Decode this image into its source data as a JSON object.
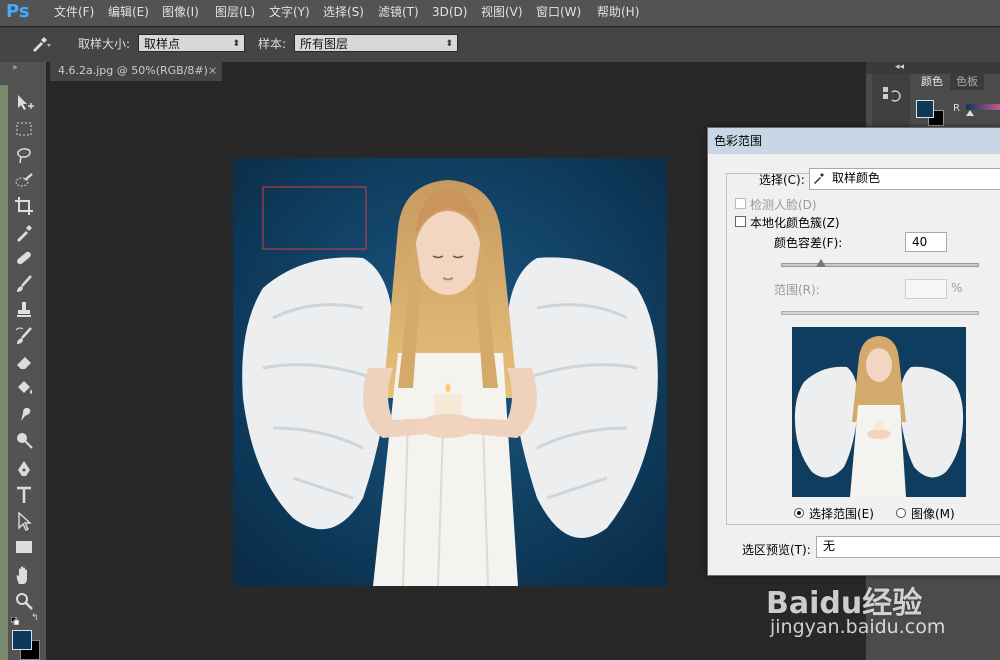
{
  "app": {
    "logo": "Ps"
  },
  "menu": [
    "文件(F)",
    "编辑(E)",
    "图像(I)",
    "图层(L)",
    "文字(Y)",
    "选择(S)",
    "滤镜(T)",
    "3D(D)",
    "视图(V)",
    "窗口(W)",
    "帮助(H)"
  ],
  "options": {
    "sample_size_label": "取样大小:",
    "sample_size_value": "取样点",
    "sample_label": "样本:",
    "sample_value": "所有图层"
  },
  "document": {
    "tab_title": "4.6.2a.jpg @ 50%(RGB/8#)",
    "close": "×"
  },
  "panels": {
    "tab_color": "颜色",
    "tab_swatches": "色板",
    "channel_r": "R"
  },
  "dialog": {
    "title": "色彩范围",
    "select_label": "选择(C):",
    "select_value": "取样颜色",
    "detect_faces": "检测人脸(D)",
    "localized_clusters": "本地化颜色簇(Z)",
    "fuzziness_label": "颜色容差(F):",
    "fuzziness_value": "40",
    "fuzziness_level": 0.2,
    "range_label": "范围(R):",
    "range_unit": "%",
    "radio_selection": "选择范围(E)",
    "radio_image": "图像(M)",
    "preview_label": "选区预览(T):",
    "preview_value": "无"
  },
  "watermark": {
    "text": "Baidu经验",
    "url": "jingyan.baidu.com"
  },
  "colors": {
    "foreground": "#0b3a5c",
    "background": "#000000",
    "selection_rect": "#d04040"
  }
}
